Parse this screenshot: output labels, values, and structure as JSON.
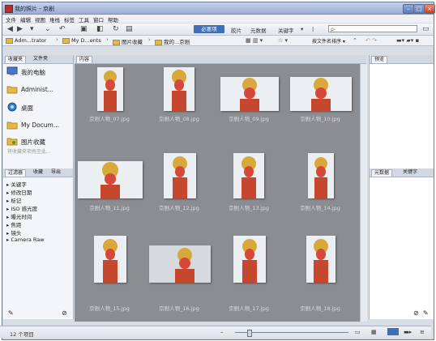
{
  "window": {
    "title": "我的照片 - 京剧"
  },
  "menu": [
    "文件",
    "编辑",
    "视图",
    "堆栈",
    "标签",
    "工具",
    "窗口",
    "帮助"
  ],
  "toolbar": {
    "workspaces": {
      "active": "必要项",
      "others": [
        "胶片",
        "元数据",
        "关键字"
      ]
    },
    "search_placeholder": "ρ-"
  },
  "breadcrumb": [
    "Adm...trator",
    "My D...ents",
    "图片收藏",
    "我的...京剧"
  ],
  "sort_label": "按文件名排序 ▾",
  "left_tabs": [
    "收藏夹",
    "文件夹"
  ],
  "favorites": [
    {
      "label": "我的电脑",
      "icon": "computer-icon"
    },
    {
      "label": "Administ...",
      "icon": "folder-icon"
    },
    {
      "label": "桌面",
      "icon": "desktop-icon"
    },
    {
      "label": "My Docum...",
      "icon": "folder-icon"
    },
    {
      "label": "图片收藏",
      "icon": "pictures-icon"
    }
  ],
  "favorites_hint": "将收藏夹项拖至此...",
  "filter_tabs": [
    "过滤器",
    "收藏",
    "导出"
  ],
  "filters": [
    "关键字",
    "修改日期",
    "标记",
    "ISO 感光度",
    "曝光时间",
    "焦距",
    "镜头",
    "Camera Raw"
  ],
  "content_tab": "内容",
  "right_tabs": {
    "preview": "预览",
    "metadata": "元数据",
    "keywords": "关键字"
  },
  "thumbnails": [
    "京剧人物_07.jpg",
    "京剧人物_08.jpg",
    "京剧人物_09.jpg",
    "京剧人物_10.jpg",
    "京剧人物_11.jpg",
    "京剧人物_12.jpg",
    "京剧人物_13.jpg",
    "京剧人物_14.jpg",
    "京剧人物_15.jpg",
    "京剧人物_16.jpg",
    "京剧人物_17.jpg",
    "京剧人物_18.jpg"
  ],
  "status": "12 个项目",
  "colors": {
    "accent": "#3f6fb8",
    "grid_bg": "#8a8d92",
    "folder": "#e6b84a"
  }
}
